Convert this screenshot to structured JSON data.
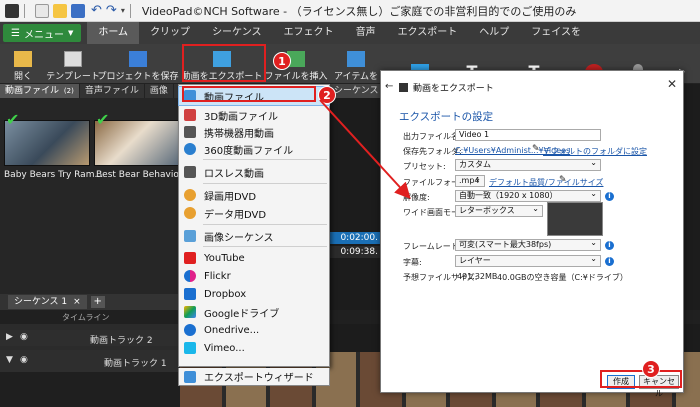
{
  "window": {
    "title": "VideoPad©NCH Software - （ライセンス無し）ご家庭での非営利目的でのご使用のみ"
  },
  "menubar": {
    "menu_button": "メニュー",
    "tabs": [
      "ホーム",
      "クリップ",
      "シーケンス",
      "エフェクト",
      "音声",
      "エクスポート",
      "ヘルプ",
      "フェイスを"
    ]
  },
  "toolbar": {
    "open": "開く",
    "template": "テンプレート",
    "save_project": "プロジェクトを保存",
    "export_video": "動画をエクスポート",
    "insert_file": "ファイルを挿入",
    "item": "アイテムを"
  },
  "media": {
    "tabs": [
      "動画ファイル",
      "音声ファイル",
      "画像"
    ],
    "tab_count": "(2)",
    "thumbs": [
      "Baby Bears Try Ram...",
      "Best Bear Behavior _..."
    ]
  },
  "preview": {
    "tab": "シーケンス",
    "time1": "0:02:00.",
    "time2": "0:09:38."
  },
  "sequence": {
    "tab": "シーケンス 1",
    "add": "+",
    "timeline": "タイムライン",
    "track2": "動画トラック 2",
    "track1": "動画トラック 1"
  },
  "dropdown": {
    "items": [
      "動画ファイル",
      "3D動画ファイル",
      "携帯機器用動画",
      "360度動画ファイル",
      "ロスレス動画",
      "録画用DVD",
      "データ用DVD",
      "画像シーケンス",
      "YouTube",
      "Flickr",
      "Dropbox",
      "Googleドライブ",
      "Onedrive...",
      "Vimeo...",
      "エクスポートウィザード"
    ]
  },
  "dialog": {
    "title": "動画をエクスポート",
    "heading": "エクスポートの設定",
    "fields": {
      "filename_label": "出力ファイル名:",
      "filename_value": "Video 1",
      "folder_label": "保存先フォルダ:",
      "folder_value": "C:¥Users¥Administ...¥Videos",
      "folder_link": "デフォルトのフォルダに設定",
      "preset_label": "プリセット:",
      "preset_value": "カスタム",
      "format_label": "ファイルフォーマット:",
      "format_value": ".mp4",
      "format_link": "デフォルト品質/ファイルサイズ",
      "resolution_label": "解像度:",
      "resolution_value": "自動一致（1920 x 1080）",
      "widescreen_label": "ワイド画面モード:",
      "widescreen_value": "レターボックス",
      "framerate_label": "フレームレート:",
      "framerate_value": "可変(スマート最大38fps)",
      "subtitle_label": "字幕:",
      "subtitle_value": "レイヤー",
      "filesize_label": "予想ファイルサイズ:",
      "filesize_value": "491.32MB",
      "free_space": "40.0GBの空き容量（C:¥ドライブ）"
    },
    "create_button": "作成",
    "cancel_button": "キャンセル"
  },
  "annotations": {
    "badge1": "1",
    "badge2": "2",
    "badge3": "3"
  },
  "colors": {
    "accent_red": "#e02020",
    "brand_green": "#2f8a3c",
    "link_blue": "#1a55a8",
    "highlight": "#cce4f7"
  }
}
